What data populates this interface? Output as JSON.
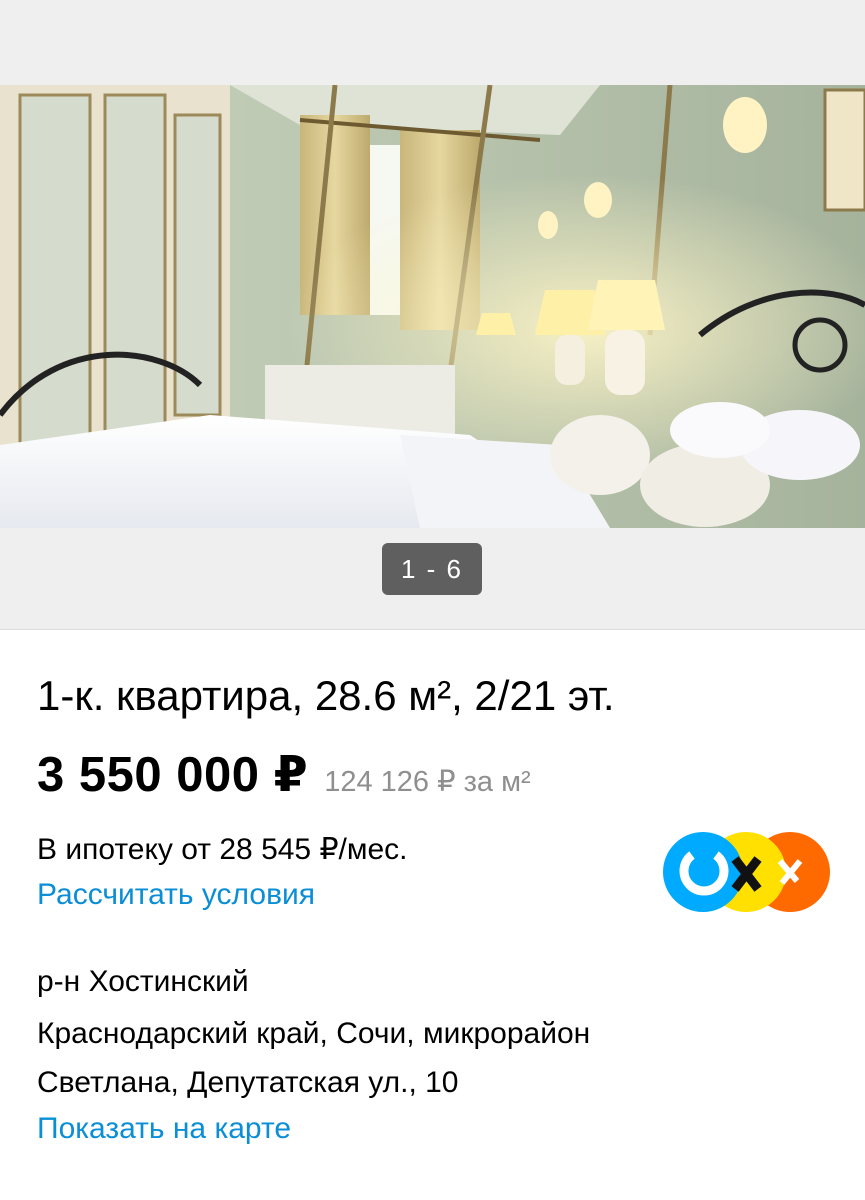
{
  "gallery": {
    "counter": "1 - 6",
    "photo_alt": "bedroom-photo"
  },
  "listing": {
    "title": "1-к. квартира, 28.6 м², 2/21 эт.",
    "price": "3 550 000 ₽",
    "price_per_m2": "124 126 ₽ за м²",
    "mortgage": "В ипотеку от 28 545 ₽/мес.",
    "calc_link": "Рассчитать условия",
    "district": "р-н Хостинский",
    "address_line1": "Краснодарский край, Сочи, микрорайон",
    "address_line2": "Светлана, Депутатская ул., 10",
    "map_link": "Показать на карте"
  },
  "colors": {
    "link": "#0a8ed6",
    "muted": "#8f8f8f",
    "counter_bg": "#5f5f5f",
    "logo_blue": "#00aaff",
    "logo_yellow": "#ffe000",
    "logo_orange": "#ff6a00"
  }
}
